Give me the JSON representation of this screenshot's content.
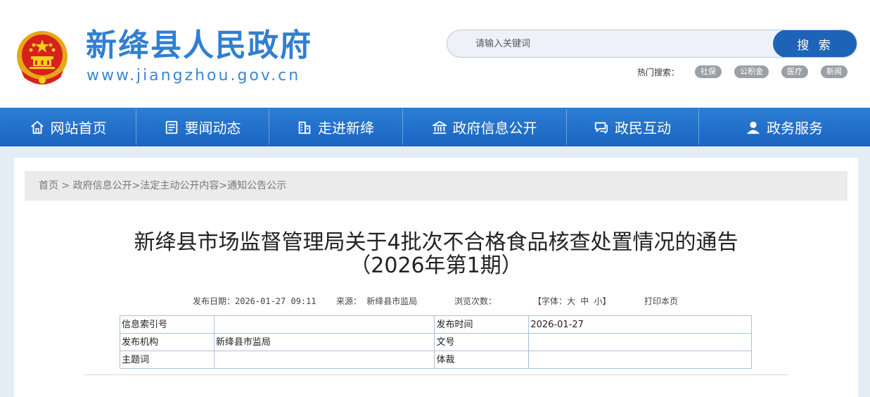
{
  "header": {
    "site_title": "新绛县人民政府",
    "site_url": "www.jiangzhou.gov.cn"
  },
  "search": {
    "placeholder": "请输入关键词",
    "button_label": "搜 索",
    "hot_label": "热门搜索：",
    "hot_tags": [
      "社保",
      "公积金",
      "医疗",
      "新闻"
    ]
  },
  "nav": {
    "items": [
      {
        "label": "网站首页",
        "icon": "home-icon"
      },
      {
        "label": "要闻动态",
        "icon": "news-icon"
      },
      {
        "label": "走进新绛",
        "icon": "building-icon"
      },
      {
        "label": "政府信息公开",
        "icon": "government-icon"
      },
      {
        "label": "政民互动",
        "icon": "chat-icon"
      },
      {
        "label": "政务服务",
        "icon": "user-icon"
      }
    ]
  },
  "breadcrumb": {
    "items": [
      "首页",
      "政府信息公开",
      "法定主动公开内容",
      "通知公告公示"
    ],
    "separators": [
      " > ",
      ">",
      ">"
    ]
  },
  "article": {
    "title_line1": "新绛县市场监督管理局关于4批次不合格食品核查处置情况的通告",
    "title_line2": "（2026年第1期）",
    "publish_date": "发布日期：2026-01-27 09:11",
    "source": "来源： 新绛县市监局",
    "views": "浏览次数：",
    "font_size": "【字体：大 中 小】",
    "print": "打印本页"
  },
  "info_table": {
    "rows": [
      [
        "信息索引号",
        "",
        "发布时间",
        "2026-01-27"
      ],
      [
        "发布机构",
        "新绛县市监局",
        "文号",
        ""
      ],
      [
        "主题词",
        "",
        "体裁",
        ""
      ]
    ]
  },
  "colors": {
    "brand_blue": "#2f7fd3",
    "nav_blue": "#1a64c0",
    "search_button": "#1d63b8"
  }
}
